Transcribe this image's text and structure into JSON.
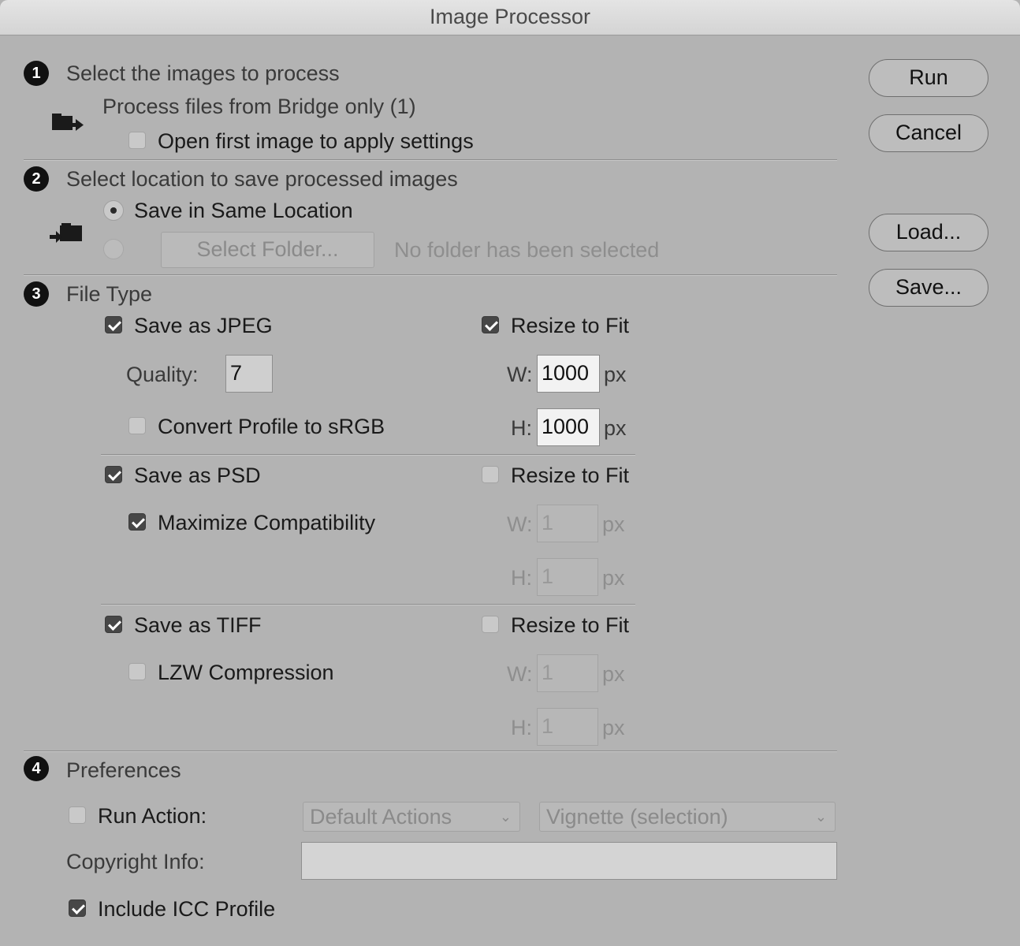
{
  "window": {
    "title": "Image Processor"
  },
  "section1": {
    "number": "1",
    "heading": "Select the images to process",
    "source_text": "Process files from Bridge only (1)",
    "open_first_label": "Open first image to apply settings",
    "open_first_checked": false,
    "icon": "folder-arrow-icon"
  },
  "section2": {
    "number": "2",
    "heading": "Select location to save processed images",
    "same_location_label": "Save in Same Location",
    "same_location_selected": true,
    "select_folder_label": "Select Folder...",
    "no_folder_text": "No folder has been selected",
    "icon": "save-to-folder-icon"
  },
  "section3": {
    "number": "3",
    "heading": "File Type",
    "jpeg": {
      "save_label": "Save as JPEG",
      "save_checked": true,
      "quality_label": "Quality:",
      "quality_value": "7",
      "convert_label": "Convert Profile to sRGB",
      "convert_checked": false,
      "resize_label": "Resize to Fit",
      "resize_checked": true,
      "w_label": "W:",
      "w_value": "1000",
      "h_label": "H:",
      "h_value": "1000",
      "unit": "px"
    },
    "psd": {
      "save_label": "Save as PSD",
      "save_checked": true,
      "maxcompat_label": "Maximize Compatibility",
      "maxcompat_checked": true,
      "resize_label": "Resize to Fit",
      "resize_checked": false,
      "w_label": "W:",
      "w_value": "1",
      "h_label": "H:",
      "h_value": "1",
      "unit": "px"
    },
    "tiff": {
      "save_label": "Save as TIFF",
      "save_checked": true,
      "lzw_label": "LZW Compression",
      "lzw_checked": false,
      "resize_label": "Resize to Fit",
      "resize_checked": false,
      "w_label": "W:",
      "w_value": "1",
      "h_label": "H:",
      "h_value": "1",
      "unit": "px"
    }
  },
  "section4": {
    "number": "4",
    "heading": "Preferences",
    "run_action_label": "Run Action:",
    "run_action_checked": false,
    "action_set": "Default Actions",
    "action": "Vignette (selection)",
    "copyright_label": "Copyright Info:",
    "copyright_value": "",
    "icc_label": "Include ICC Profile",
    "icc_checked": true
  },
  "buttons": {
    "run": "Run",
    "cancel": "Cancel",
    "load": "Load...",
    "save": "Save..."
  }
}
